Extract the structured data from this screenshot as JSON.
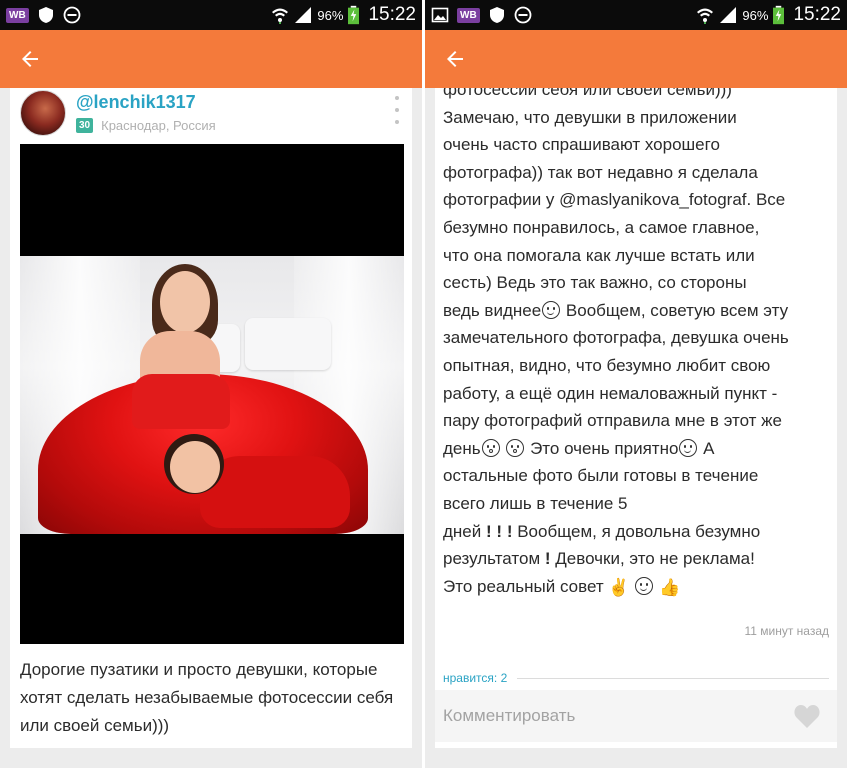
{
  "status_bar": {
    "battery_percent": "96%",
    "time": "15:22",
    "left_badge": "WB"
  },
  "left_screen": {
    "post": {
      "username": "@lenchik1317",
      "age_badge": "30",
      "location": "Краснодар, Россия",
      "text": "Дорогие пузатики и просто девушки, которые хотят сделать незабываемые фотосессии себя или своей семьи)))"
    }
  },
  "right_screen": {
    "lines": {
      "l0": "фотосессии себя или своей семьи)))",
      "l1": "Замечаю, что девушки в приложении",
      "l2": "очень часто спрашивают хорошего",
      "l3": "фотографа)) так вот недавно я сделала",
      "l4": "фотографии у @maslyanikova_fotograf. Все",
      "l5": "безумно понравилось, а самое главное,",
      "l6": "что она помогала как лучше встать или",
      "l7": "сесть) Ведь это так важно, со стороны",
      "l8a": "ведь виднее",
      "l8b": " Вообщем, советую всем эту",
      "l9": "замечательного фотографа, девушка очень",
      "l10": "опытная, видно, что безумно любит свою",
      "l11": "работу, а ещё один немаловажный пункт -",
      "l12": "пару фотографий отправила мне в этот же",
      "l13a": "день",
      "l13b": " Это очень приятно",
      "l13c": " А",
      "l14": "остальные фото были готовы в течение",
      "l15": "всего лишь в течение 5",
      "l16a": "дней",
      "l16b": " Вообщем, я довольна безумно",
      "l17a": "результатом",
      "l17b": " Девочки, это не реклама!",
      "l18": "Это реальный совет",
      "bang1": "!",
      "bang2": "!",
      "bang3": "!",
      "bang4": "!",
      "victory": "✌",
      "thumbs": "👍"
    },
    "timestamp": "11 минут назад",
    "likes": "нравится: 2",
    "comment_placeholder": "Комментировать"
  },
  "colors": {
    "accent_orange": "#f47a3b",
    "link_teal": "#2aa3c4",
    "badge_green": "#3fb39c",
    "status_bar": "#0b0b0b"
  },
  "icons": [
    "back-arrow-icon",
    "heart-icon",
    "wifi-icon",
    "signal-icon",
    "battery-icon",
    "shield-icon",
    "minus-circle-icon",
    "image-icon",
    "more-vertical-icon"
  ]
}
